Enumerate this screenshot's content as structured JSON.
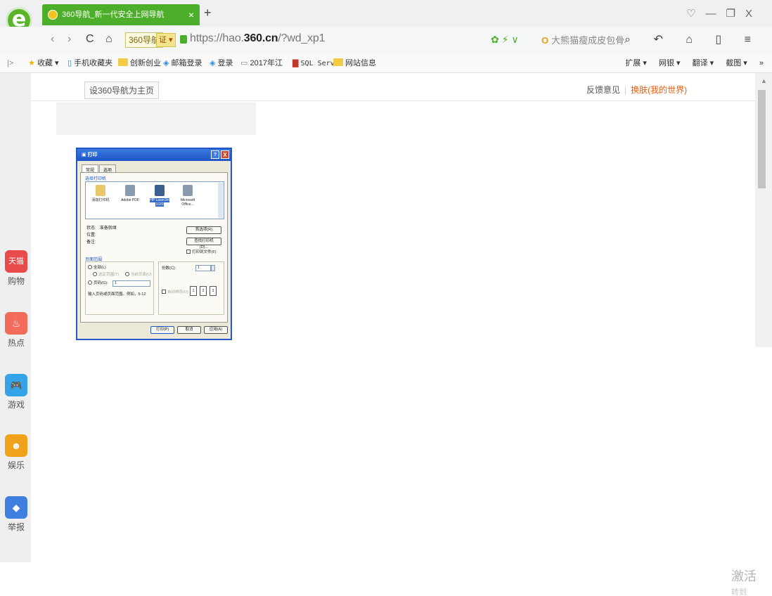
{
  "browser": {
    "tab": {
      "title": "360导航_新一代安全上网导航",
      "close": "×"
    },
    "new_tab": "+",
    "window_controls": {
      "skin": "♡",
      "minimize": "—",
      "restore": "❐",
      "close": "X"
    },
    "nav": {
      "back": "‹",
      "forward": "›",
      "refresh": "C",
      "home": "⌂"
    },
    "site_tag": "360导航",
    "cert_label": "证 ▾",
    "url_prefix": "https://hao.",
    "url_domain": "360.cn",
    "url_path": "/?wd_xp1",
    "security_icons": "✿ ⚡ ∨",
    "search": {
      "logo": "O",
      "placeholder": "大熊猫瘦成皮包骨"
    },
    "toolbar_glyphs": "⌕ ↶ ⌂ ▯ ≡"
  },
  "bookmarks": {
    "toggle": "|>",
    "items": [
      {
        "label": "收藏 ▾"
      },
      {
        "label": "手机收藏夹"
      },
      {
        "label": "创新创业"
      },
      {
        "label": "邮箱登录"
      },
      {
        "label": "登录"
      },
      {
        "label": "2017年江"
      },
      {
        "label": "SQL Serv"
      },
      {
        "label": "网站信息"
      }
    ],
    "right": [
      "扩展 ▾",
      "网银 ▾",
      "翻译 ▾",
      "截图 ▾",
      "»"
    ]
  },
  "page": {
    "set_homepage": "设360导航为主页",
    "feedback": "反馈意见",
    "separator": "|",
    "skin": "换肤(我的世界)"
  },
  "sidebar": [
    {
      "label": "购物",
      "badge": "天猫",
      "color": "#e94b4b"
    },
    {
      "label": "热点",
      "badge": "♨",
      "color": "#f26b5b"
    },
    {
      "label": "游戏",
      "badge": "🎮",
      "color": "#35a3e8"
    },
    {
      "label": "娱乐",
      "badge": "☻",
      "color": "#f0a21c"
    },
    {
      "label": "举报",
      "badge": "◆",
      "color": "#3f7fe0"
    }
  ],
  "print_dialog": {
    "title": "打印",
    "help": "?",
    "close": "X",
    "tabs": [
      "常规",
      "选项"
    ],
    "select_printer_label": "选择打印机",
    "printers": [
      {
        "label": "添加打印机"
      },
      {
        "label": "Adobe PDF"
      },
      {
        "label": "HP LaserJet 1020",
        "selected": true
      },
      {
        "label": "Microsoft Office..."
      }
    ],
    "status_label": "状态:",
    "status_value": "准备就绪",
    "location_label": "位置:",
    "comment_label": "备注:",
    "preferences_button": "首选项(R)",
    "find_printer_button": "查找打印机(D)...",
    "print_to_file": "打印到文件(F)",
    "page_range_label": "页面范围",
    "range_all": "全部(L)",
    "range_selection": "选定范围(T)",
    "range_current": "当前页面(U)",
    "range_pages": "页码(G):",
    "pages_value": "1",
    "pages_hint": "输入页码或页面范围。例如，5-12",
    "copies_label": "份数(C):",
    "copies_value": "1",
    "collate_label": "自动排序(O)",
    "print_button": "打印(P)",
    "cancel_button": "取消",
    "apply_button": "应用(A)"
  },
  "watermark": {
    "line1": "激活",
    "line2": "转到"
  }
}
